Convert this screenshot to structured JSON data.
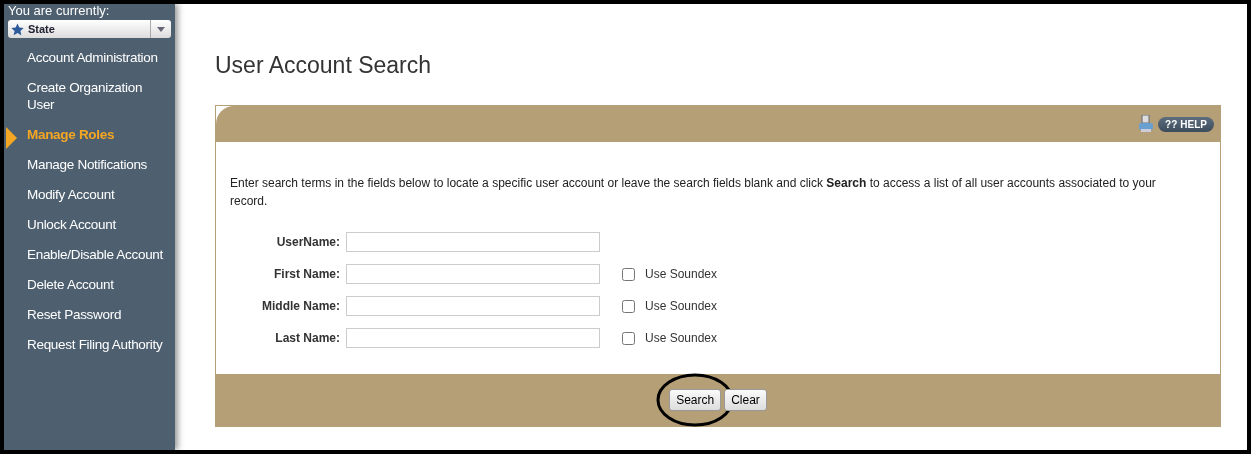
{
  "sidebar": {
    "context_label": "You are currently:",
    "context_value": "State",
    "items": [
      {
        "label": "Account Administration",
        "selected": false
      },
      {
        "label": "Create Organization User",
        "selected": false
      },
      {
        "label": "Manage Roles",
        "selected": true
      },
      {
        "label": "Manage Notifications",
        "selected": false
      },
      {
        "label": "Modify Account",
        "selected": false
      },
      {
        "label": "Unlock Account",
        "selected": false
      },
      {
        "label": "Enable/Disable Account",
        "selected": false
      },
      {
        "label": "Delete Account",
        "selected": false
      },
      {
        "label": "Reset Password",
        "selected": false
      },
      {
        "label": "Request Filing Authority",
        "selected": false
      }
    ]
  },
  "page_title": "User Account Search",
  "panel": {
    "help": {
      "glyph": "??",
      "label": "HELP"
    },
    "instructions": "Enter search terms in the fields below to locate a specific user account or leave the search fields blank and click **Search** to access a list of all user accounts associated to your record.",
    "fields": [
      {
        "label": "UserName:"
      },
      {
        "label": "First Name:",
        "soundex": {
          "label": "Use Soundex",
          "checked": false
        }
      },
      {
        "label": "Middle Name:",
        "soundex": {
          "label": "Use Soundex",
          "checked": false
        }
      },
      {
        "label": "Last Name:",
        "soundex": {
          "label": "Use Soundex",
          "checked": false
        }
      }
    ],
    "buttons": [
      {
        "label": "Search",
        "highlighted": true
      },
      {
        "label": "Clear",
        "highlighted": false
      }
    ]
  }
}
